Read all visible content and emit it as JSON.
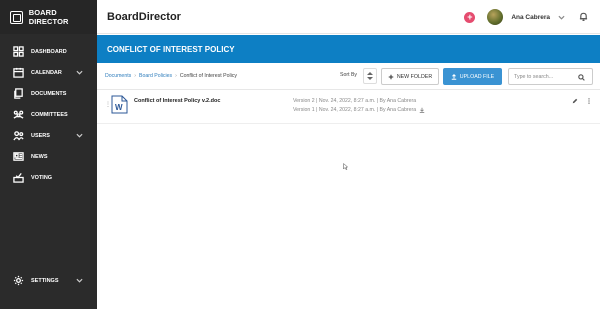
{
  "sidebar": {
    "brand": "BOARD DIRECTOR",
    "items": [
      {
        "label": "DASHBOARD",
        "icon": "dashboard-icon",
        "has_chevron": false
      },
      {
        "label": "CALENDAR",
        "icon": "calendar-icon",
        "has_chevron": true
      },
      {
        "label": "DOCUMENTS",
        "icon": "documents-icon",
        "has_chevron": false
      },
      {
        "label": "COMMITTEES",
        "icon": "committees-icon",
        "has_chevron": false
      },
      {
        "label": "USERS",
        "icon": "users-icon",
        "has_chevron": true
      },
      {
        "label": "NEWS",
        "icon": "news-icon",
        "has_chevron": false
      },
      {
        "label": "VOTING",
        "icon": "voting-icon",
        "has_chevron": false
      }
    ],
    "settings_label": "SETTINGS"
  },
  "topbar": {
    "title": "BoardDirector",
    "user_name": "Ana Cabrera"
  },
  "banner": {
    "title": "CONFLICT OF INTEREST POLICY"
  },
  "toolbar": {
    "breadcrumb": [
      "Documents",
      "Board Policies",
      "Conflict of Interest Policy"
    ],
    "sort_label": "Sort By",
    "new_folder_label": "NEW FOLDER",
    "upload_label": "UPLOAD FILE",
    "search_placeholder": "Type to search..."
  },
  "files": [
    {
      "name": "Conflict of Interest Policy v.2.doc",
      "versions": [
        "Version 2 | Nov. 24, 2022, 8:27 a.m. | By Ana Cabrera",
        "Version 1 | Nov. 24, 2022, 8:27 a.m. | By Ana Cabrera"
      ]
    }
  ],
  "colors": {
    "sidebar": "#2b2b2b",
    "banner": "#0d7fc4",
    "upload_button": "#3a93d3",
    "plus_button": "#e54c6f",
    "link": "#2e7dbc"
  }
}
